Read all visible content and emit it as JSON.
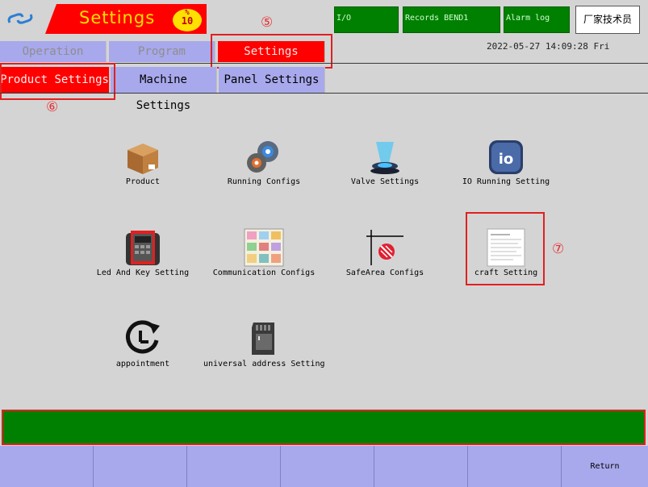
{
  "header": {
    "title": "Settings",
    "badge_symbol": "%",
    "badge_value": "10",
    "buttons": [
      "I/O",
      "Records BEND1",
      "Alarm log",
      "厂家技术员"
    ]
  },
  "menu": {
    "tabs": [
      "Operation",
      "Program",
      "Settings"
    ],
    "active": "Settings",
    "datetime": "2022-05-27  14:09:28  Fri"
  },
  "subtabs": {
    "items": [
      "Product Settings",
      "Machine Settings",
      "Panel Settings"
    ],
    "active": "Product Settings"
  },
  "annotations": [
    "⑤",
    "⑥",
    "⑦"
  ],
  "grid": {
    "items": [
      {
        "label": "Product",
        "icon": "box-icon"
      },
      {
        "label": "Running Configs",
        "icon": "gears-icon"
      },
      {
        "label": "Valve Settings",
        "icon": "hologram-icon"
      },
      {
        "label": "IO Running Setting",
        "icon": "io-icon"
      },
      {
        "label": "Led And Key Setting",
        "icon": "keypad-icon"
      },
      {
        "label": "Communication Configs",
        "icon": "collage-icon"
      },
      {
        "label": "SafeArea Configs",
        "icon": "safearea-icon"
      },
      {
        "label": "craft Setting",
        "icon": "document-icon"
      },
      {
        "label": "appointment",
        "icon": "clock-icon"
      },
      {
        "label": "universal address Setting",
        "icon": "sdcard-icon"
      }
    ]
  },
  "footer": {
    "buttons": [
      "",
      "",
      "",
      "",
      "",
      "",
      "Return"
    ]
  },
  "colors": {
    "accent_red": "#ff0000",
    "tab_purple": "#a8a8ec",
    "status_green": "#008000",
    "title_yellow": "#ffe000"
  }
}
